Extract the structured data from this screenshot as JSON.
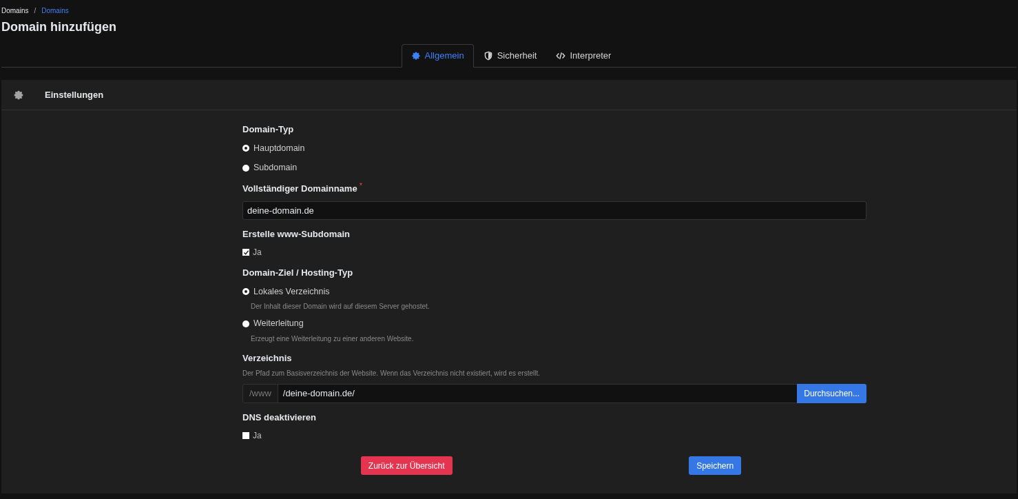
{
  "breadcrumb": [
    {
      "label": "Domains",
      "kind": "text"
    },
    {
      "label": "Domains",
      "kind": "link"
    }
  ],
  "breadcrumb_separator": "/",
  "title": "Domain hinzufügen",
  "tabs": [
    {
      "label": "Allgemein",
      "selected": true
    },
    {
      "label": "Sicherheit",
      "selected": false
    },
    {
      "label": "Interpreter",
      "selected": false
    }
  ],
  "panel": {
    "title": "Einstellungen"
  },
  "fields": [
    {
      "kind": "radio",
      "label": "Domain-Typ",
      "options": [
        {
          "label": "Hauptdomain",
          "selected": true
        },
        {
          "label": "Subdomain",
          "selected": false
        }
      ]
    },
    {
      "kind": "text",
      "label": "Vollständiger Domainname",
      "required": true,
      "required_mark": "*",
      "value": "deine-domain.de"
    },
    {
      "kind": "checkbox",
      "label": "Erstelle www-Subdomain",
      "option": "Ja",
      "checked": true
    },
    {
      "kind": "radio",
      "label": "Domain-Ziel / Hosting-Typ",
      "options": [
        {
          "label": "Lokales Verzeichnis",
          "hint": "Der Inhalt dieser Domain wird auf diesem Server gehostet.",
          "selected": true
        },
        {
          "label": "Weiterleitung",
          "hint": "Erzeugt eine Weiterleitung zu einer anderen Website.",
          "selected": false
        }
      ]
    },
    {
      "kind": "path",
      "label": "Verzeichnis",
      "hint": "Der Pfad zum Basisverzeichnis der Website. Wenn das Verzeichnis nicht existiert, wird es erstellt.",
      "prefix": "/www",
      "value": "/deine-domain.de/",
      "button": "Durchsuchen..."
    },
    {
      "kind": "checkbox",
      "label": "DNS deaktivieren",
      "option": "Ja",
      "checked": false
    }
  ],
  "actions": [
    {
      "label": "Zurück zur Übersicht",
      "kind": "danger"
    },
    {
      "label": "Speichern",
      "kind": "primary"
    }
  ]
}
